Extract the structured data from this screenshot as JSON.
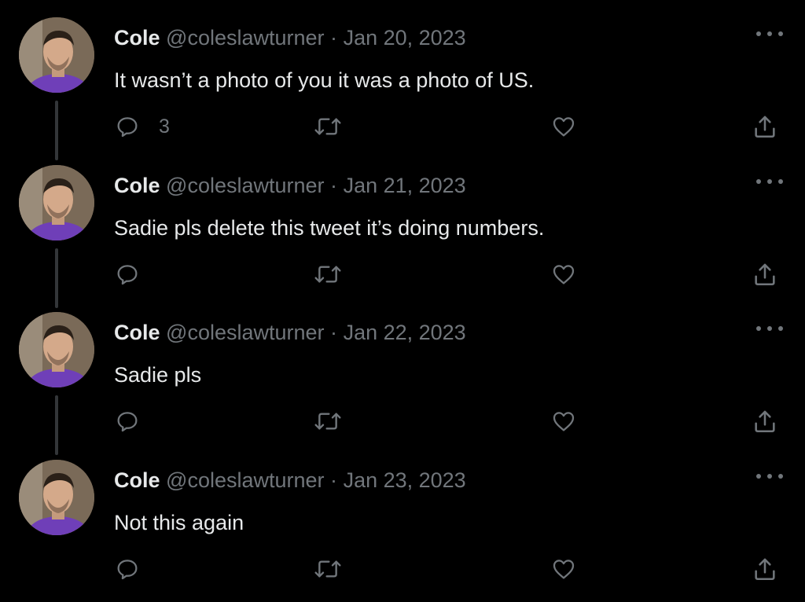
{
  "tweets": [
    {
      "name": "Cole",
      "handle": "@coleslawturner",
      "separator": "·",
      "date": "Jan 20, 2023",
      "text": "It wasn’t a photo of you it was a photo of US.",
      "reply_count": "3"
    },
    {
      "name": "Cole",
      "handle": "@coleslawturner",
      "separator": "·",
      "date": "Jan 21, 2023",
      "text": "Sadie pls delete this tweet it’s doing numbers.",
      "reply_count": ""
    },
    {
      "name": "Cole",
      "handle": "@coleslawturner",
      "separator": "·",
      "date": "Jan 22, 2023",
      "text": "Sadie pls",
      "reply_count": ""
    },
    {
      "name": "Cole",
      "handle": "@coleslawturner",
      "separator": "·",
      "date": "Jan 23, 2023",
      "text": "Not this again",
      "reply_count": ""
    }
  ],
  "icons": {
    "reply": "reply-icon",
    "retweet": "retweet-icon",
    "like": "heart-icon",
    "share": "share-icon",
    "more": "more-icon"
  },
  "colors": {
    "background": "#000000",
    "text_primary": "#e7e9ea",
    "text_secondary": "#71767b",
    "thread_line": "#333639",
    "shirt": "#6f3fb8"
  }
}
